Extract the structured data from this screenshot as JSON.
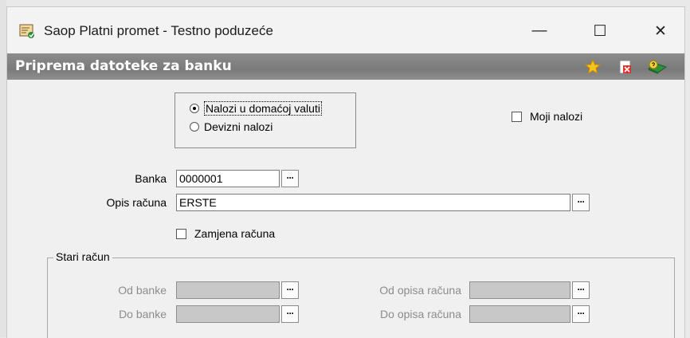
{
  "window": {
    "title": "Saop Platni promet - Testno poduzeće",
    "controls": {
      "minimize": "—",
      "maximize": "☐",
      "close": "✕"
    },
    "app_icon": "app-document-icon"
  },
  "form": {
    "title": "Priprema datoteke za banku",
    "toolbar_icons": [
      "favorite-star-icon",
      "close-document-icon",
      "book-help-icon"
    ]
  },
  "payment_type": {
    "options": [
      {
        "label": "Nalozi u domaćoj valuti",
        "selected": true
      },
      {
        "label": "Devizni nalozi",
        "selected": false
      }
    ]
  },
  "moji_nalozi": {
    "label": "Moji nalozi",
    "checked": false
  },
  "banka": {
    "label": "Banka",
    "value": "0000001"
  },
  "opis_racuna": {
    "label": "Opis računa",
    "value": "ERSTE"
  },
  "zamjena_racuna": {
    "label": "Zamjena računa",
    "checked": false
  },
  "stari_racun": {
    "title": "Stari račun",
    "od_banke": {
      "label": "Od banke",
      "value": ""
    },
    "do_banke": {
      "label": "Do banke",
      "value": ""
    },
    "od_opisa": {
      "label": "Od opisa računa",
      "value": ""
    },
    "do_opisa": {
      "label": "Do opisa računa",
      "value": ""
    }
  },
  "lookup_button_label": "···",
  "colors": {
    "caption_bar": "#808080",
    "window_bg": "#f0f0f0",
    "disabled_field": "#c8c8c8"
  }
}
